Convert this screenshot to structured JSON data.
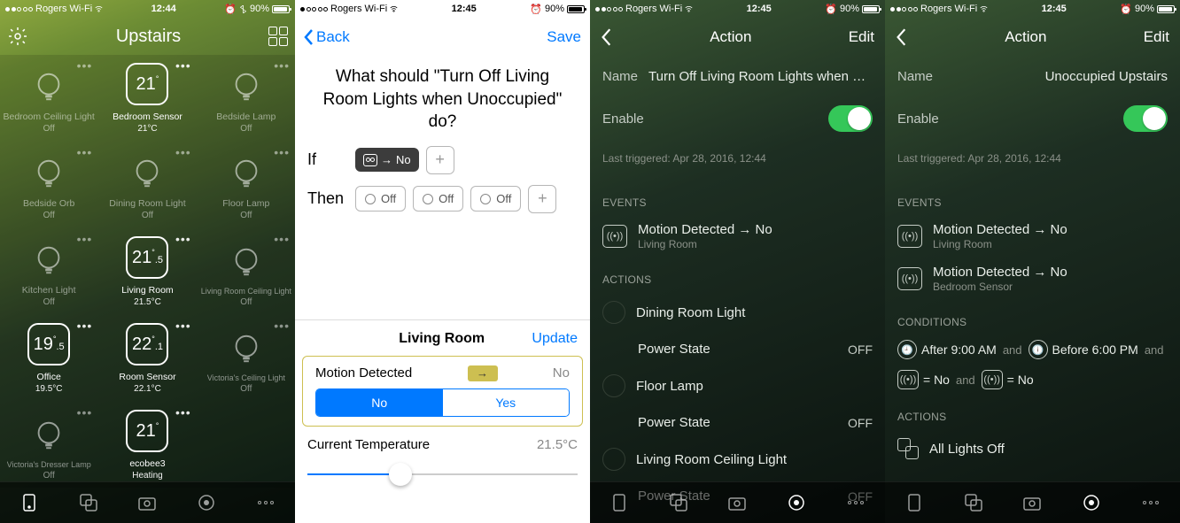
{
  "status": {
    "carrier": "Rogers Wi-Fi",
    "time1": "12:44",
    "time234": "12:45",
    "batt": "90%"
  },
  "s1": {
    "title": "Upstairs",
    "tiles": [
      {
        "name": "Bedroom Ceiling Light",
        "sub": "Off",
        "dim": true,
        "type": "bulb"
      },
      {
        "name": "Bedroom Sensor",
        "sub": "21°C",
        "type": "sensor",
        "big": "21"
      },
      {
        "name": "Bedside Lamp",
        "sub": "Off",
        "dim": true,
        "type": "bulb"
      },
      {
        "name": "Bedside Orb",
        "sub": "Off",
        "dim": true,
        "type": "bulb"
      },
      {
        "name": "Dining Room Light",
        "sub": "Off",
        "dim": true,
        "type": "bulb"
      },
      {
        "name": "Floor Lamp",
        "sub": "Off",
        "dim": true,
        "type": "bulb"
      },
      {
        "name": "Kitchen Light",
        "sub": "Off",
        "dim": true,
        "type": "bulb"
      },
      {
        "name": "Living Room",
        "sub": "21.5°C",
        "type": "sensor",
        "big": "21",
        "frac": ".5"
      },
      {
        "name": "Living Room Ceiling Light",
        "sub": "Off",
        "dim": true,
        "type": "bulb",
        "small": true
      },
      {
        "name": "Office",
        "sub": "19.5°C",
        "type": "sensor",
        "big": "19",
        "frac": ".5"
      },
      {
        "name": "Room Sensor",
        "sub": "22.1°C",
        "type": "sensor",
        "big": "22",
        "frac": ".1"
      },
      {
        "name": "Victoria's Ceiling Light",
        "sub": "Off",
        "dim": true,
        "type": "bulb",
        "small": true
      },
      {
        "name": "Victoria's Dresser Lamp",
        "sub": "Off",
        "dim": true,
        "type": "bulb",
        "small": true
      },
      {
        "name": "ecobee3",
        "sub": "Heating",
        "type": "sensor",
        "big": "21"
      }
    ]
  },
  "s2": {
    "back": "Back",
    "save": "Save",
    "heading": "What should \"Turn Off Living Room Lights when Unoccupied\" do?",
    "if": "If",
    "then": "Then",
    "no": "No",
    "off": "Off",
    "room": "Living Room",
    "update": "Update",
    "attr1": "Motion Detected",
    "attr1val": "No",
    "segNo": "No",
    "segYes": "Yes",
    "attr2": "Current Temperature",
    "attr2val": "21.5°C"
  },
  "s3": {
    "title": "Action",
    "edit": "Edit",
    "nameL": "Name",
    "nameV": "Turn Off Living Room Lights when Unoccup…",
    "enable": "Enable",
    "last": "Last triggered: Apr 28, 2016, 12:44",
    "events": "EVENTS",
    "evt": "Motion Detected → No",
    "evtroom": "Living Room",
    "actions": "ACTIONS",
    "alist": [
      {
        "n": "Dining Room Light"
      },
      {
        "n": "Power State",
        "v": "OFF",
        "c": true
      },
      {
        "n": "Floor Lamp"
      },
      {
        "n": "Power State",
        "v": "OFF",
        "c": true
      },
      {
        "n": "Living Room Ceiling Light"
      },
      {
        "n": "Power State",
        "v": "OFF",
        "c": true
      }
    ]
  },
  "s4": {
    "title": "Action",
    "edit": "Edit",
    "nameL": "Name",
    "nameV": "Unoccupied Upstairs",
    "enable": "Enable",
    "last": "Last triggered: Apr 28, 2016, 12:44",
    "events": "EVENTS",
    "ev": [
      {
        "t": "Motion Detected → No",
        "s": "Living Room"
      },
      {
        "t": "Motion Detected → No",
        "s": "Bedroom Sensor"
      }
    ],
    "conditions": "CONDITIONS",
    "c1": "After 9:00 AM",
    "c2": "Before 6:00 PM",
    "cand": "and",
    "c3": "= No",
    "c4": "= No",
    "actions": "ACTIONS",
    "actionName": "All Lights Off"
  }
}
